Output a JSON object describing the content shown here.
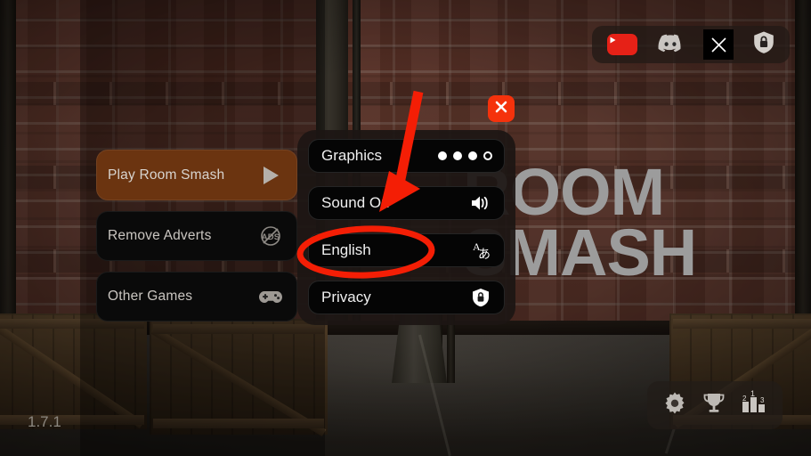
{
  "app": {
    "title_line1": "ROOM",
    "title_line2": "SMASH",
    "version": "1.7.1"
  },
  "main_menu": {
    "items": [
      {
        "label": "Play Room Smash",
        "icon": "play-triangle-icon",
        "style": "primary"
      },
      {
        "label": "Remove Adverts",
        "icon": "no-ads-icon",
        "style": "dark"
      },
      {
        "label": "Other Games",
        "icon": "gamepad-icon",
        "style": "dark"
      }
    ]
  },
  "settings_panel": {
    "close_label": "✕",
    "close_icon": "close-x-icon",
    "items": [
      {
        "label": "Graphics",
        "icon": "quality-dots-icon",
        "value": "3 of 4"
      },
      {
        "label": "Sound On",
        "icon": "speaker-on-icon",
        "value": "on"
      },
      {
        "label": "English",
        "icon": "language-icon",
        "value": "English"
      },
      {
        "label": "Privacy",
        "icon": "shield-lock-icon",
        "value": ""
      }
    ],
    "graphics_dots": {
      "total": 4,
      "filled": 3
    }
  },
  "social_bar": {
    "items": [
      {
        "name": "YouTube",
        "icon": "youtube-icon"
      },
      {
        "name": "Discord",
        "icon": "discord-icon"
      },
      {
        "name": "X",
        "icon": "x-twitter-icon"
      },
      {
        "name": "Privacy",
        "icon": "shield-lock-icon"
      }
    ]
  },
  "bottom_bar": {
    "items": [
      {
        "name": "Settings",
        "icon": "gear-icon"
      },
      {
        "name": "Achievements",
        "icon": "trophy-icon"
      },
      {
        "name": "Leaderboard",
        "icon": "podium-icon",
        "places": [
          "2",
          "1",
          "3"
        ]
      }
    ]
  },
  "annotations": {
    "arrow": {
      "color": "#F41E05",
      "points_to": "Sound On"
    },
    "ellipse": {
      "color": "#F41E05",
      "highlights": "English"
    }
  },
  "colors": {
    "accent_orange": "#6B3410",
    "close_red": "#F5320C",
    "annotation_red": "#F41E05",
    "logo_gray": "#9C9C9C",
    "panel_bg": "#1C1613",
    "button_dark": "#050505"
  }
}
